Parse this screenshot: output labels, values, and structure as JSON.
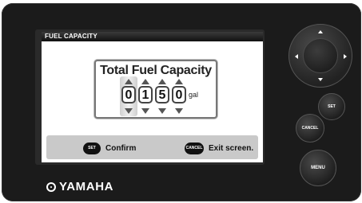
{
  "screen": {
    "title": "FUEL CAPACITY",
    "dialog_title": "Total Fuel Capacity",
    "digits": [
      "0",
      "1",
      "5",
      "0"
    ],
    "selected_digit_index": 0,
    "unit": "gal"
  },
  "hints": {
    "set_badge": "SET",
    "set_text": "Confirm",
    "cancel_badge": "CANCEL",
    "cancel_text": "Exit screen."
  },
  "hardware": {
    "logo": "YAMAHA",
    "set_label": "SET",
    "cancel_label": "CANCEL",
    "menu_label": "MENU"
  }
}
